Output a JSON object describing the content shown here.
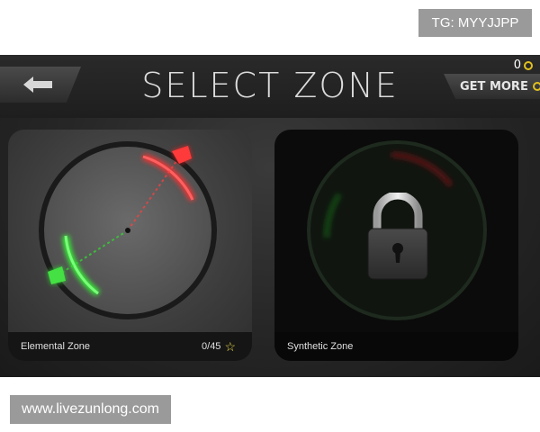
{
  "watermarks": {
    "top": "TG: MYYJJPP",
    "bottom": "www.livezunlong.com"
  },
  "header": {
    "back_icon": "arrow-left-icon",
    "title": "SELECT ZONE",
    "coins": "0",
    "get_more_label": "GET MORE"
  },
  "zones": [
    {
      "name": "Elemental Zone",
      "progress": "0/45",
      "locked": false,
      "icon": "star-icon"
    },
    {
      "name": "Synthetic Zone",
      "locked": true,
      "icon": "lock-icon"
    }
  ],
  "colors": {
    "red_dart": "#e02020",
    "green_dart": "#30d030",
    "coin": "#e0c020",
    "star": "#e6d84a"
  }
}
